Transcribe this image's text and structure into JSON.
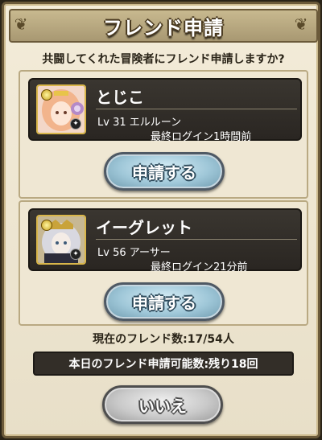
{
  "dialog": {
    "title": "フレンド申請",
    "question": "共闘してくれた冒険者にフレンド申請しますか?"
  },
  "players": [
    {
      "name": "とじこ",
      "level_class": "Lv 31 エルルーン",
      "last_login": "最終ログイン1時間前",
      "button_label": "申請する",
      "portrait_colors": {
        "hair": "#f2b48c",
        "bg": "#f3d7c8",
        "accent": "#b48ac8"
      }
    },
    {
      "name": "イーグレット",
      "level_class": "Lv 56 アーサー",
      "last_login": "最終ログイン21分前",
      "button_label": "申請する",
      "portrait_colors": {
        "hair": "#d8d8e0",
        "bg": "#c7b894",
        "accent": "#c9a33a"
      }
    }
  ],
  "friend_count": "現在のフレンド数:17/54人",
  "requests_remaining": "本日のフレンド申請可能数:残り18回",
  "no_button_label": "いいえ",
  "colors": {
    "card_bg": "#2f2b26",
    "panel_bg": "#efe7d3",
    "dialog_bg": "#f0e8d3",
    "button_blue": "#9fc7d8",
    "button_gray": "#c9c9c9"
  }
}
